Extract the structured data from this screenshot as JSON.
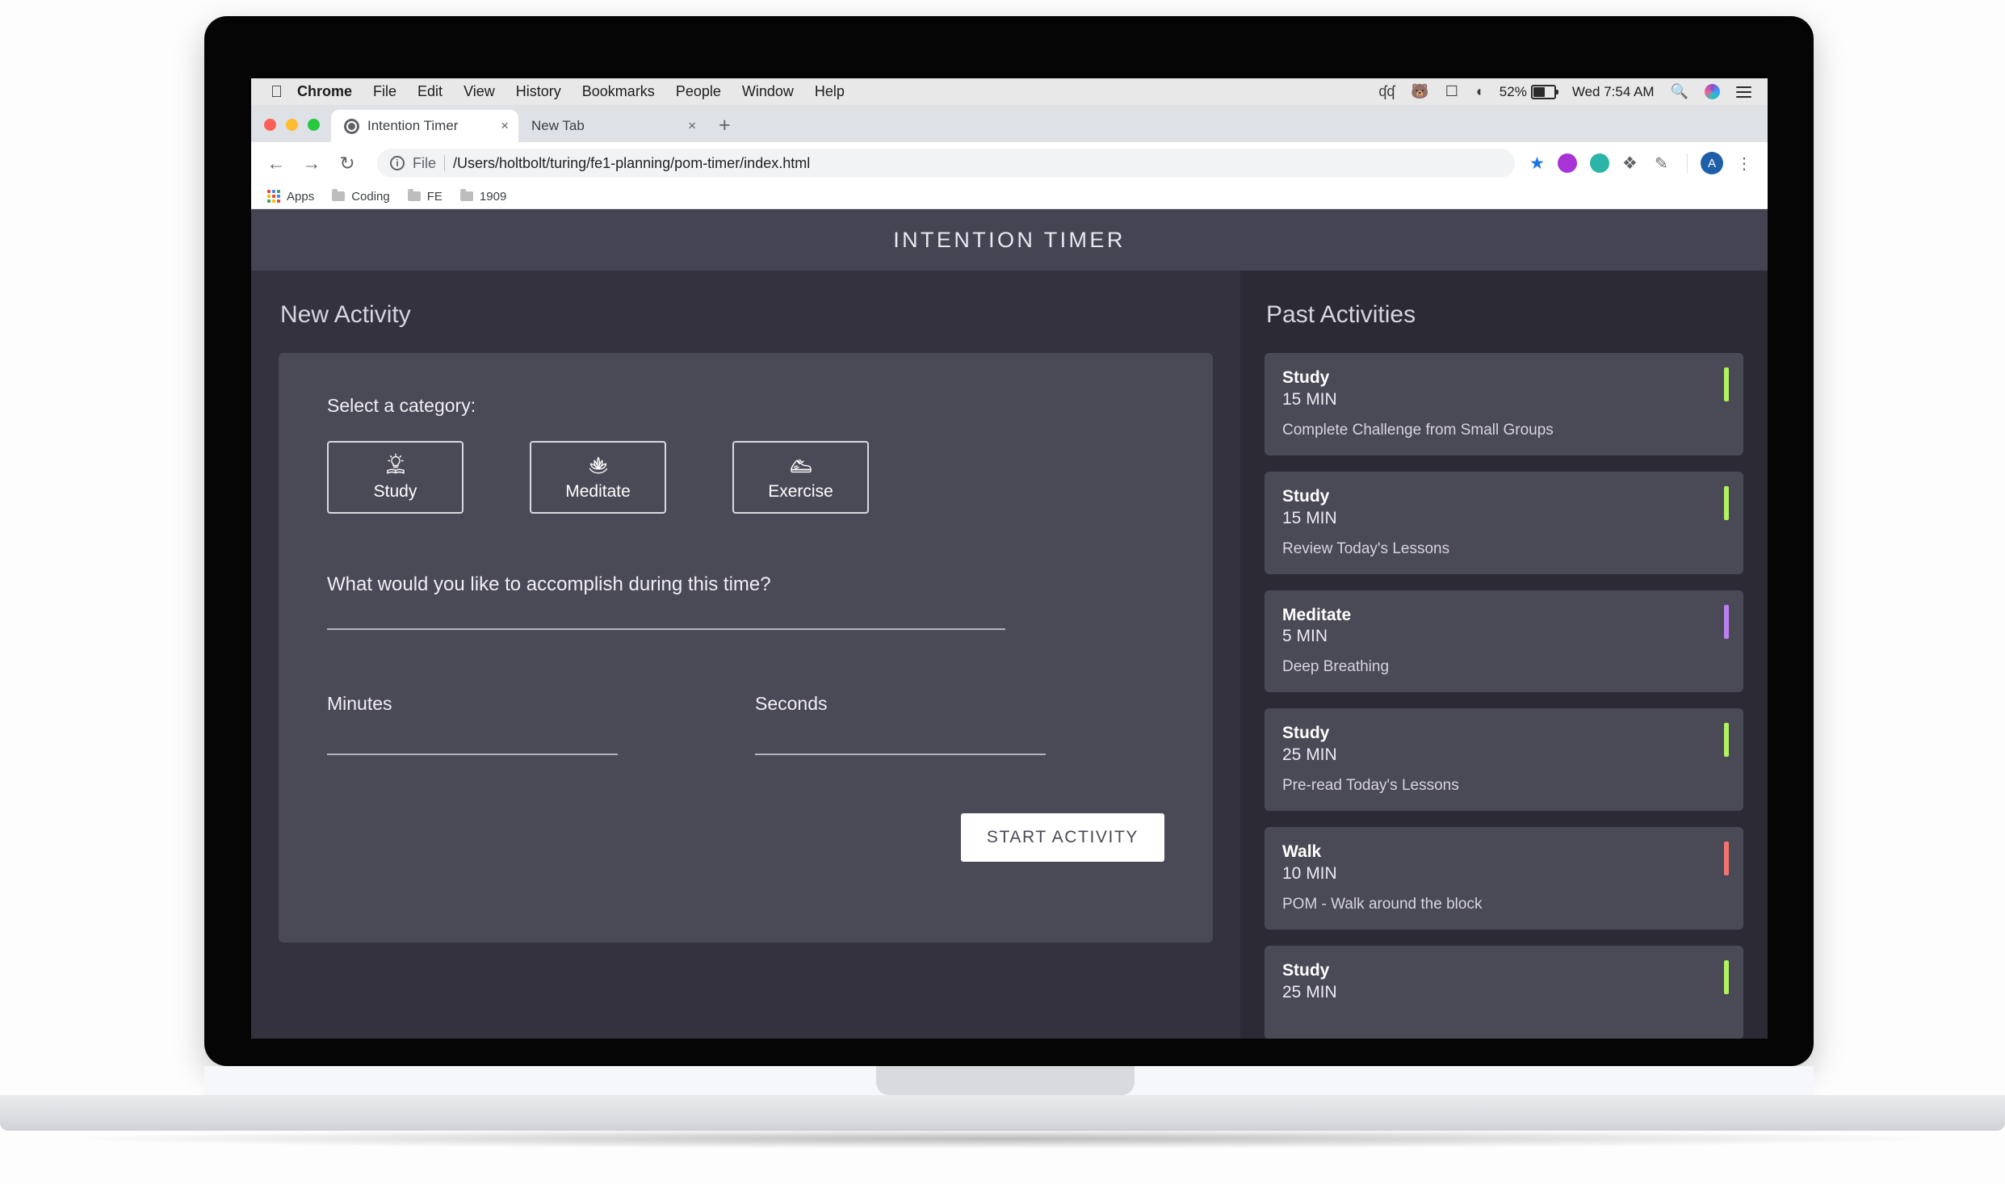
{
  "macbar": {
    "apple_icon": "apple-icon",
    "menus": [
      "Chrome",
      "File",
      "Edit",
      "View",
      "History",
      "Bookmarks",
      "People",
      "Window",
      "Help"
    ],
    "status": {
      "glasses_icon": "glasses-icon",
      "bear_icon": "bear-icon",
      "airplay_icon": "airplay-icon",
      "wifi_icon": "wifi-icon",
      "battery_percent": "52%",
      "battery_icon": "battery-icon",
      "clock": "Wed 7:54 AM",
      "search_icon": "search-icon",
      "siri_icon": "siri-icon",
      "control_center_icon": "control-center-icon"
    }
  },
  "browser": {
    "tabs": [
      {
        "title": "Intention Timer",
        "favicon": "globe-icon",
        "close": "×",
        "active": true
      },
      {
        "title": "New Tab",
        "favicon": "",
        "close": "×",
        "active": false
      }
    ],
    "new_tab_label": "+",
    "nav": {
      "back": "←",
      "forward": "→",
      "reload": "↻"
    },
    "omnibox": {
      "info_icon": "info-icon",
      "scheme_label": "File",
      "url": "/Users/holtbolt/turing/fe1-planning/pom-timer/index.html"
    },
    "toolbar_right": {
      "bookmark_star_icon": "star-icon",
      "extension_1_icon": "extension-purple-icon",
      "extension_2_icon": "extension-teal-icon",
      "extension_3_icon": "extension-diamond-icon",
      "extension_4_icon": "extension-pen-icon",
      "profile_initial": "A",
      "menu_icon": "kebab-menu-icon"
    },
    "bookmarks": [
      {
        "label": "Apps",
        "icon": "apps-grid-icon"
      },
      {
        "label": "Coding",
        "icon": "folder-icon"
      },
      {
        "label": "FE",
        "icon": "folder-icon"
      },
      {
        "label": "1909",
        "icon": "folder-icon"
      }
    ]
  },
  "app": {
    "header_title": "INTENTION TIMER",
    "left": {
      "pane_title": "New Activity",
      "category_prompt": "Select a category:",
      "categories": [
        {
          "label": "Study",
          "icon": "lightbulb-book-icon",
          "selected": true
        },
        {
          "label": "Meditate",
          "icon": "lotus-icon",
          "selected": false
        },
        {
          "label": "Exercise",
          "icon": "sneaker-icon",
          "selected": false
        }
      ],
      "accomplish_prompt": "What would you like to accomplish during this time?",
      "accomplish_value": "",
      "minutes_label": "Minutes",
      "minutes_value": "",
      "seconds_label": "Seconds",
      "seconds_value": "",
      "start_button": "START ACTIVITY"
    },
    "right": {
      "pane_title": "Past Activities",
      "activities": [
        {
          "category": "Study",
          "duration": "15 MIN",
          "description": "Complete Challenge from Small Groups",
          "color": "#b0f260"
        },
        {
          "category": "Study",
          "duration": "15 MIN",
          "description": "Review Today's Lessons",
          "color": "#b0f260"
        },
        {
          "category": "Meditate",
          "duration": "5 MIN",
          "description": "Deep Breathing",
          "color": "#bc7ef0"
        },
        {
          "category": "Study",
          "duration": "25 MIN",
          "description": "Pre-read Today's Lessons",
          "color": "#b0f260"
        },
        {
          "category": "Walk",
          "duration": "10 MIN",
          "description": "POM - Walk around the block",
          "color": "#f4736f"
        },
        {
          "category": "Study",
          "duration": "25 MIN",
          "description": "",
          "color": "#b0f260"
        }
      ]
    },
    "colors": {
      "header_bg": "#454453",
      "left_bg": "#33323e",
      "right_bg": "#2b2a35",
      "card_bg": "#4a4956",
      "study": "#b0f260",
      "meditate": "#bc7ef0",
      "walk": "#f4736f"
    }
  }
}
